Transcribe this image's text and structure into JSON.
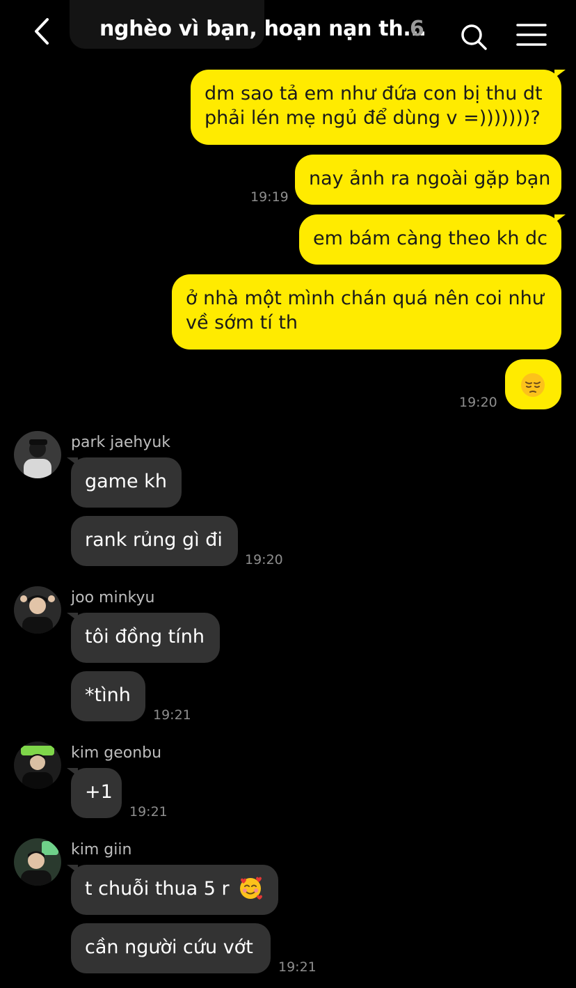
{
  "header": {
    "title": "nghèo vì bạn, hoạn nạn th...",
    "member_count": "6",
    "back_icon": "chevron-left-icon",
    "search_icon": "search-icon",
    "menu_icon": "hamburger-menu-icon"
  },
  "colors": {
    "outgoing_bubble": "#ffeb00",
    "incoming_bubble": "#333333",
    "background": "#000000"
  },
  "outgoing": [
    {
      "lines": [
        "dm sao tả em như đứa con bị thu dt",
        "phải lén mẹ ngủ để dùng v =)))))))?"
      ]
    },
    {
      "text": "nay ảnh ra ngoài gặp bạn",
      "time": "19:19"
    },
    {
      "text": "em bám càng theo kh dc"
    },
    {
      "lines": [
        "ở nhà một mình chán quá nên coi như",
        "về sớm tí th"
      ]
    },
    {
      "emoji": "pensive-face-emoji",
      "time": "19:20"
    }
  ],
  "groups": [
    {
      "sender": "park jaehyuk",
      "messages": [
        "game kh",
        "rank rủng gì đi"
      ],
      "time": "19:20"
    },
    {
      "sender": "joo minkyu",
      "messages": [
        "tôi đồng tính",
        "*tình"
      ],
      "time": "19:21"
    },
    {
      "sender": "kim geonbu",
      "messages": [
        "+1"
      ],
      "time": "19:21"
    },
    {
      "sender": "kim giin",
      "messages": [
        "t chuỗi thua 5 r",
        "cần người cứu vớt"
      ],
      "message_emoji": "smiling-face-with-hearts-emoji",
      "time": "19:21"
    }
  ]
}
